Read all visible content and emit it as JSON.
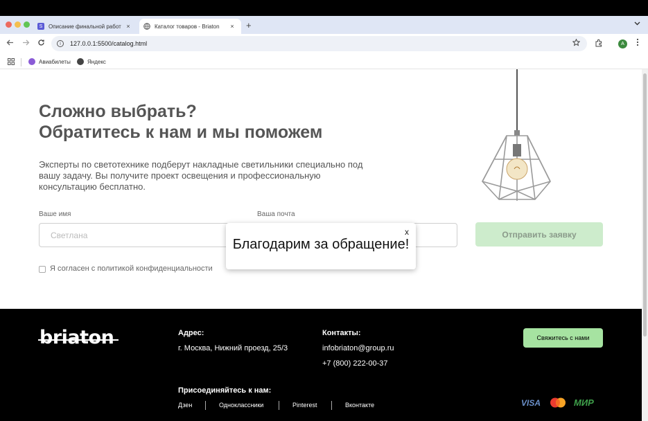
{
  "browser": {
    "tabs": [
      {
        "title": "Описание финальной работ",
        "favicon": "S",
        "favicon_color": "#5b5bd6",
        "active": false
      },
      {
        "title": "Каталог товаров - Briaton",
        "active": true
      }
    ],
    "close_glyph": "×",
    "new_tab_glyph": "+",
    "tab_menu_glyph": "⌄",
    "url": "127.0.0.1:5500/catalog.html",
    "avatar_letter": "A",
    "bookmarks": [
      {
        "label": "Авиабилеты",
        "icon_color": "#8a5bd6"
      },
      {
        "label": "Яндекс",
        "icon_color": "#444444"
      }
    ]
  },
  "page": {
    "heading_line1": "Сложно выбрать?",
    "heading_line2": "Обратитесь к нам и мы поможем",
    "description": "Эксперты по светотехнике подберут накладные светильники специально под вашу задачу. Вы получите проект освещения и профессиональную консультацию бесплатно.",
    "form": {
      "name_label": "Ваше имя",
      "name_placeholder": "Светлана",
      "email_label": "Ваша почта",
      "submit_label": "Отправить заявку",
      "consent_label": "Я согласен с политикой конфиденциальности"
    }
  },
  "modal": {
    "close_label": "x",
    "message": "Благодарим за обращение!"
  },
  "footer": {
    "logo": "briaton",
    "address_title": "Адрес:",
    "address": "г. Москва, Нижний проезд, 25/3",
    "contacts_title": "Контакты:",
    "email": "infobriaton@group.ru",
    "phone": "+7 (800) 222-00-37",
    "contact_button": "Свяжитесь с нами",
    "join_title": "Присоединяйтесь к нам:",
    "social": [
      "Дзен",
      "Одноклассники",
      "Pinterest",
      "Вконтакте"
    ],
    "payments": [
      "VISA",
      "mastercard-icon",
      "МИР"
    ]
  }
}
